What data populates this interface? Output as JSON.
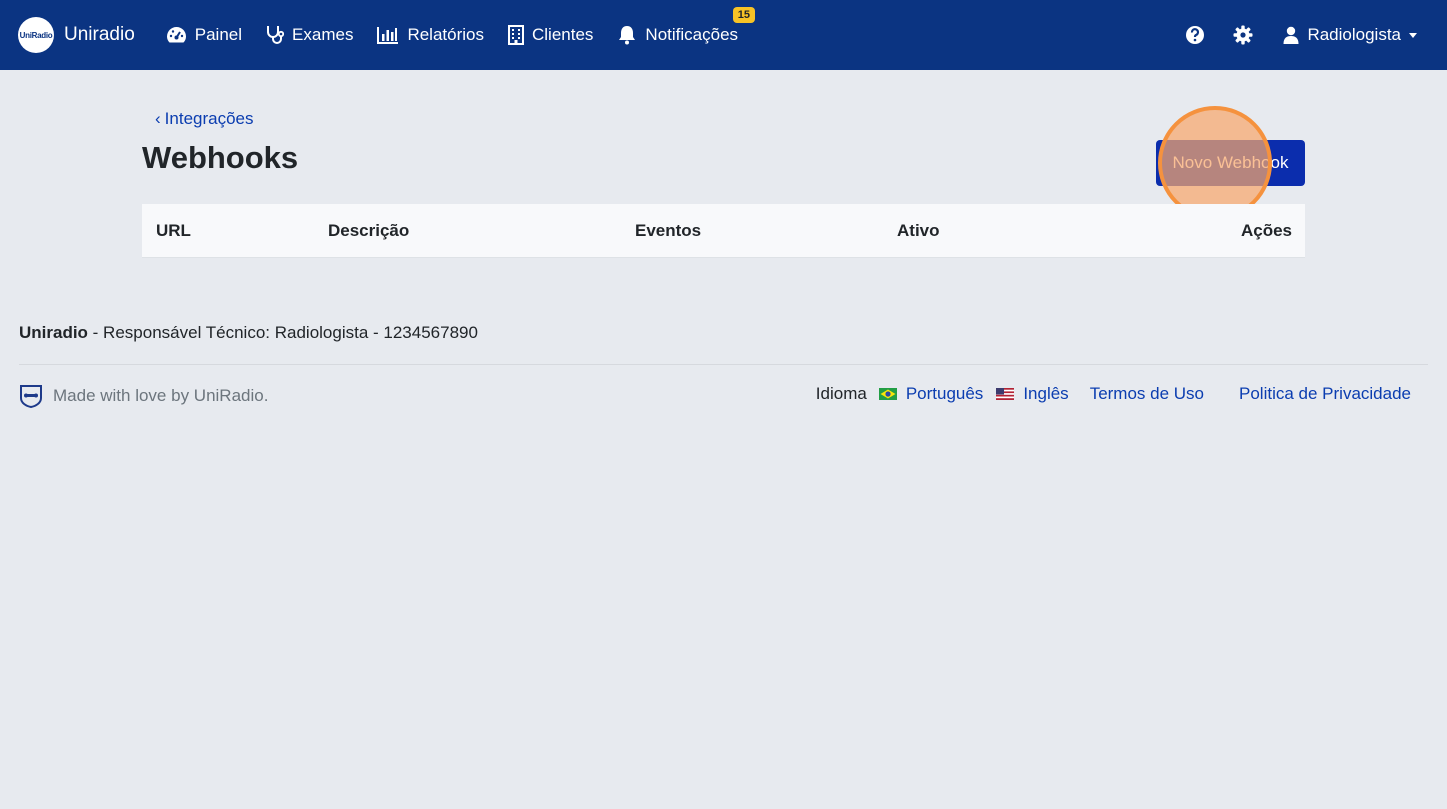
{
  "navbar": {
    "brand_logo_text": "UniRadio",
    "brand_name": "Uniradio",
    "items": [
      {
        "label": "Painel",
        "icon": "dashboard-icon"
      },
      {
        "label": "Exames",
        "icon": "stethoscope-icon"
      },
      {
        "label": "Relatórios",
        "icon": "chart-icon"
      },
      {
        "label": "Clientes",
        "icon": "building-icon"
      },
      {
        "label": "Notificações",
        "icon": "bell-icon",
        "badge": "15"
      }
    ],
    "user": "Radiologista"
  },
  "main": {
    "back_link": "Integrações",
    "title": "Webhooks",
    "new_button": "Novo Webhook",
    "table_headers": [
      "URL",
      "Descrição",
      "Eventos",
      "Ativo",
      "Ações"
    ]
  },
  "footer": {
    "company": "Uniradio",
    "responsible": " - Responsável Técnico: Radiologista - 1234567890",
    "made_with": "Made with love by UniRadio.",
    "language_label": "Idioma",
    "languages": [
      "Português",
      "Inglês"
    ],
    "terms": "Termos de Uso",
    "privacy": "Politica de Privacidade"
  },
  "colors": {
    "navbar": "#0b3482",
    "primary_button": "#0b2dad",
    "link": "#0b3db0",
    "badge": "#f7c326",
    "highlight": "#f5923e"
  }
}
